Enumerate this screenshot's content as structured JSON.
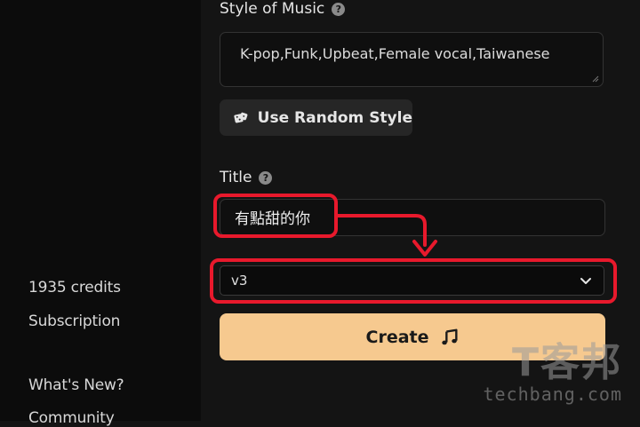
{
  "sidebar": {
    "credits": "1935 credits",
    "subscription": "Subscription",
    "whats_new": "What's New?",
    "community": "Community"
  },
  "form": {
    "style_label": "Style of Music",
    "style_value": "K-pop,Funk,Upbeat,Female vocal,Taiwanese",
    "random_style_label": "Use Random Style",
    "title_label": "Title",
    "title_value": "有點甜的你",
    "version_value": "v3",
    "create_label": "Create"
  },
  "watermark": {
    "cjk": "T客邦",
    "url": "techbang.com"
  },
  "colors": {
    "highlight": "#e8192c",
    "create_button": "#f6c98f",
    "background": "#141414",
    "sidebar": "#0c0c0c"
  },
  "icons": {
    "help": "help-circle-icon",
    "dice": "dice-icon",
    "chevron": "chevron-down-icon",
    "music": "music-note-icon"
  }
}
